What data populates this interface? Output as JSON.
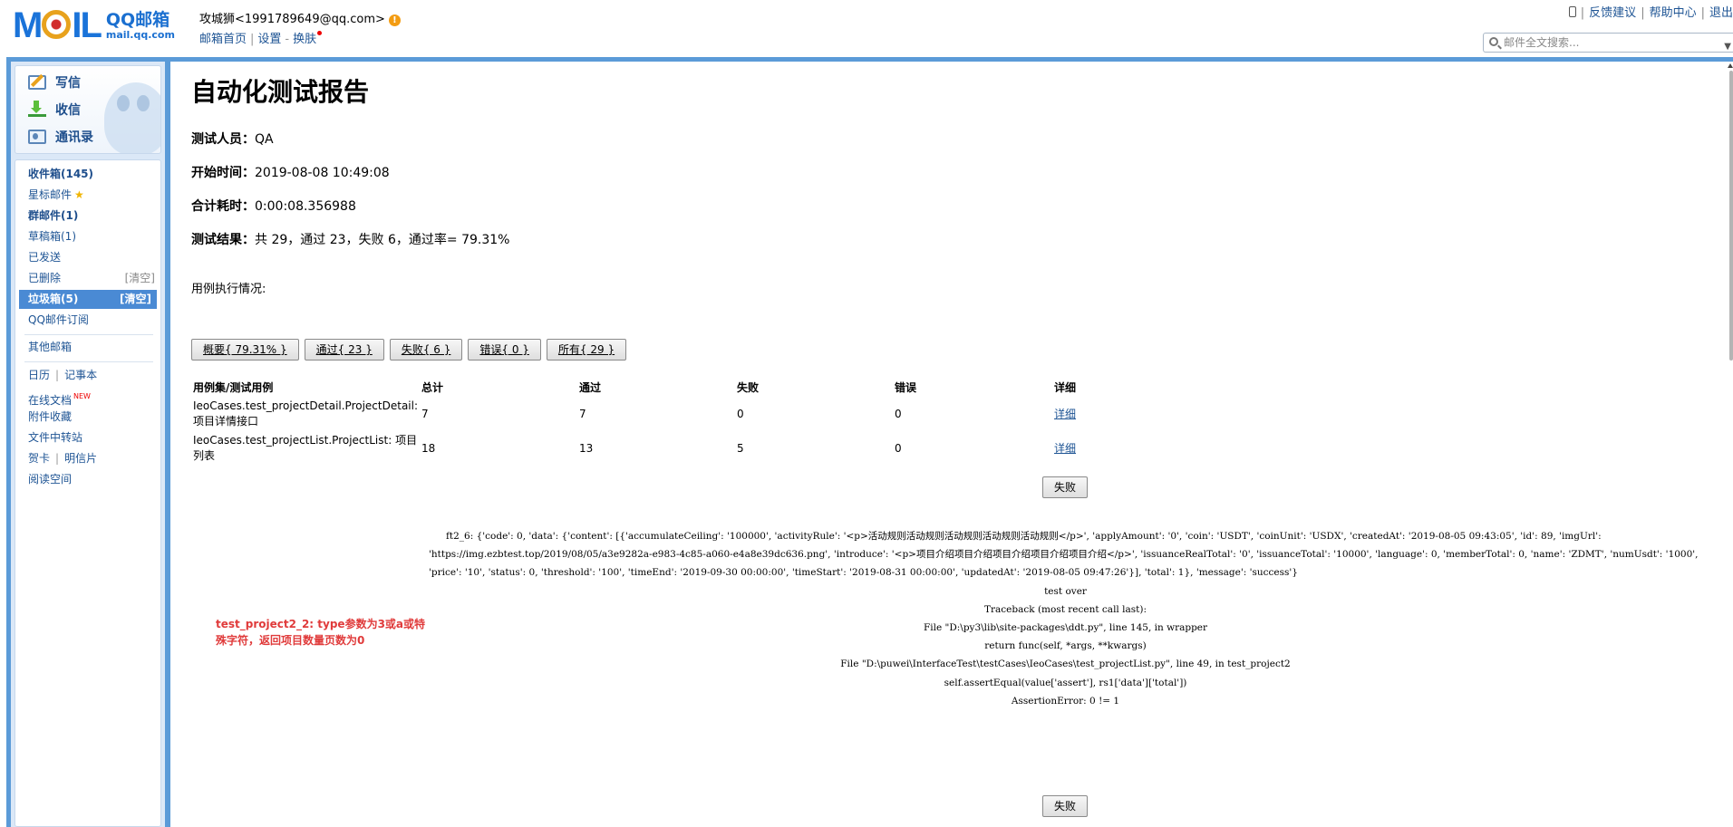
{
  "header": {
    "logo_word": "MOIL",
    "logo_brand": "QQ邮箱",
    "logo_domain": "mail.qq.com",
    "account": "攻城狮<1991789649@qq.com>",
    "links": [
      "邮箱首页",
      "设置",
      "换肤"
    ],
    "top_links": [
      "反馈建议",
      "帮助中心",
      "退出"
    ],
    "search_placeholder": "邮件全文搜索..."
  },
  "sidebar": {
    "actions": [
      "写信",
      "收信",
      "通讯录"
    ],
    "folders": [
      {
        "label": "收件箱(145)"
      },
      {
        "label": "星标邮件"
      },
      {
        "label": "群邮件(1)"
      },
      {
        "label": "草稿箱(1)"
      },
      {
        "label": "已发送"
      },
      {
        "label": "已删除",
        "action": "[清空]"
      },
      {
        "label": "垃圾箱(5)",
        "action": "[清空]"
      },
      {
        "label": "QQ邮件订阅"
      },
      {
        "label": "其他邮箱"
      },
      {
        "label": "日历"
      },
      {
        "label": "记事本"
      },
      {
        "label": "在线文档",
        "badge": "NEW"
      },
      {
        "label": "附件收藏"
      },
      {
        "label": "文件中转站"
      },
      {
        "label": "贺卡"
      },
      {
        "label": "明信片"
      },
      {
        "label": "阅读空间"
      }
    ]
  },
  "report": {
    "title": "自动化测试报告",
    "tester_label": "测试人员：",
    "tester": "QA",
    "start_label": "开始时间：",
    "start": "2019-08-08 10:49:08",
    "duration_label": "合计耗时：",
    "duration": "0:00:08.356988",
    "result_label": "测试结果：",
    "result": "共 29，通过 23，失败 6，通过率= 79.31%",
    "case_label": "用例执行情况:",
    "tabs": [
      "概要{ 79.31% }",
      "通过{ 23 }",
      "失败{ 6 }",
      "错误{ 0 }",
      "所有{ 29 }"
    ],
    "columns": [
      "用例集/测试用例",
      "总计",
      "通过",
      "失败",
      "错误",
      "详细"
    ],
    "rows": [
      {
        "name": "IeoCases.test_projectDetail.ProjectDetail: 项目详情接口",
        "total": "7",
        "pass": "7",
        "fail": "0",
        "error": "0",
        "detail": "详细"
      },
      {
        "name": "IeoCases.test_projectList.ProjectList: 项目列表",
        "total": "18",
        "pass": "13",
        "fail": "5",
        "error": "0",
        "detail": "详细"
      }
    ],
    "fail_button": "失败",
    "failed_case": "test_project2_2: type参数为3或a或特殊字符，返回项目数量页数为0",
    "log_para": "ft2_6: {'code': 0, 'data': {'content': [{'accumulateCeiling': '100000', 'activityRule': '<p>活动规则活动规则活动规则活动规则活动规则</p>', 'applyAmount': '0', 'coin': 'USDT', 'coinUnit': 'USDX', 'createdAt': '2019-08-05 09:43:05', 'id': 89, 'imgUrl': 'https://img.ezbtest.top/2019/08/05/a3e9282a-e983-4c85-a060-e4a8e39dc636.png', 'introduce': '<p>项目介绍项目介绍项目介绍项目介绍项目介绍</p>', 'issuanceRealTotal': '0', 'issuanceTotal': '10000', 'language': 0, 'memberTotal': 0, 'name': 'ZDMT', 'numUsdt': '1000', 'price': '10', 'status': 0, 'threshold': '100', 'timeEnd': '2019-09-30 00:00:00', 'timeStart': '2019-08-31 00:00:00', 'updatedAt': '2019-08-05 09:47:26'}], 'total': 1}, 'message': 'success'}",
    "log_lines": [
      "test over",
      "Traceback (most recent call last):",
      "File \"D:\\py3\\lib\\site-packages\\ddt.py\", line 145, in wrapper",
      "return func(self, *args, **kwargs)",
      "File \"D:\\puwei\\InterfaceTest\\testCases\\IeoCases\\test_projectList.py\", line 49, in test_project2",
      "self.assertEqual(value['assert'], rs1['data']['total'])",
      "AssertionError: 0 != 1"
    ]
  }
}
